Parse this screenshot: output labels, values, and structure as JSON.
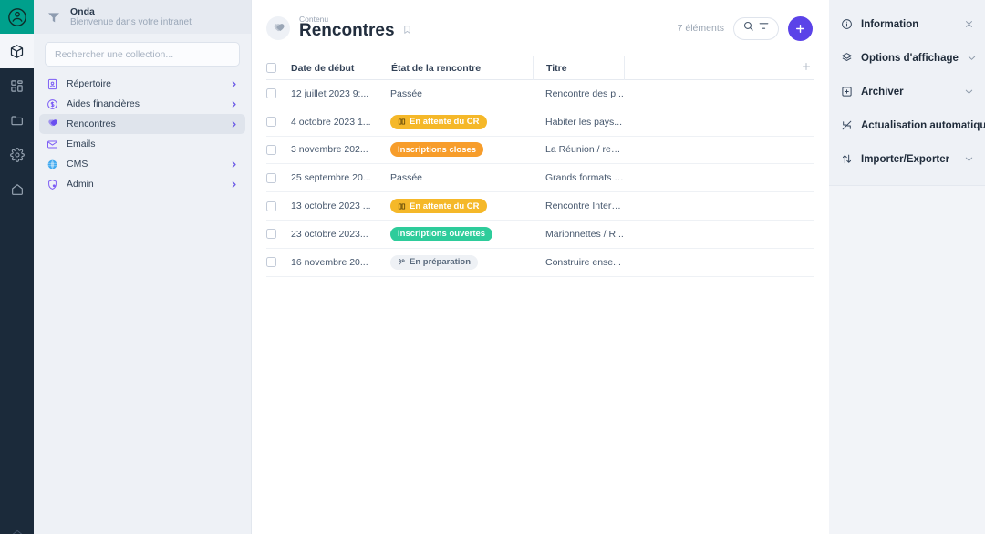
{
  "rail": {
    "logo_name": "app-logo",
    "items": [
      {
        "name": "cube-icon",
        "active": true
      },
      {
        "name": "grid-icon",
        "active": false
      },
      {
        "name": "folder-icon",
        "active": false
      },
      {
        "name": "gear-icon",
        "active": false
      },
      {
        "name": "home-icon",
        "active": false
      }
    ]
  },
  "sidebar": {
    "workspace": {
      "name": "Onda",
      "subtitle": "Bienvenue dans votre intranet",
      "icon": "workspace-logo-icon"
    },
    "search": {
      "placeholder": "Rechercher une collection...",
      "value": ""
    },
    "items": [
      {
        "label": "Répertoire",
        "icon": "contact-card-icon",
        "chevron": true,
        "active": false
      },
      {
        "label": "Aides financières",
        "icon": "dollar-circle-icon",
        "chevron": true,
        "active": false
      },
      {
        "label": "Rencontres",
        "icon": "handshake-icon",
        "chevron": true,
        "active": true
      },
      {
        "label": "Emails",
        "icon": "envelope-icon",
        "chevron": false,
        "active": false
      },
      {
        "label": "CMS",
        "icon": "globe-icon",
        "chevron": true,
        "active": false
      },
      {
        "label": "Admin",
        "icon": "shield-lock-icon",
        "chevron": true,
        "active": false
      }
    ]
  },
  "main": {
    "overline": "Contenu",
    "title": "Rencontres",
    "title_icon": "handshake-icon",
    "bookmark_icon": "bookmark-icon",
    "count": "7 éléments",
    "search_icon": "search-icon",
    "filter_icon": "filter-icon",
    "add_label": "+",
    "add_column_label": "+",
    "columns": [
      {
        "key": "date",
        "label": "Date de début"
      },
      {
        "key": "state",
        "label": "État de la rencontre"
      },
      {
        "key": "title",
        "label": "Titre"
      }
    ],
    "rows": [
      {
        "date": "12 juillet 2023 9:...",
        "state": {
          "text": "Passée",
          "style": "plain",
          "icon": null
        },
        "title": "Rencontre des p..."
      },
      {
        "date": "4 octobre 2023 1...",
        "state": {
          "text": "En attente du CR",
          "style": "amber",
          "icon": "book-icon",
          "color": "#f5b829"
        },
        "title": "Habiter les pays..."
      },
      {
        "date": "3 novembre 202...",
        "state": {
          "text": "Inscriptions closes",
          "style": "orange",
          "icon": null,
          "color": "#f79d2b"
        },
        "title": "La Réunion / ren..."
      },
      {
        "date": "25 septembre 20...",
        "state": {
          "text": "Passée",
          "style": "plain",
          "icon": null
        },
        "title": "Grands formats /..."
      },
      {
        "date": "13 octobre 2023 ...",
        "state": {
          "text": "En attente du CR",
          "style": "amber",
          "icon": "book-icon",
          "color": "#f5b829"
        },
        "title": "Rencontre Intern..."
      },
      {
        "date": "23 octobre 2023...",
        "state": {
          "text": "Inscriptions ouvertes",
          "style": "green",
          "icon": null,
          "color": "#2ecc9b"
        },
        "title": "Marionnettes / R..."
      },
      {
        "date": "16 novembre 20...",
        "state": {
          "text": "En préparation",
          "style": "gray",
          "icon": "tools-icon",
          "color": "#eef1f5"
        },
        "title": "Construire ense..."
      }
    ]
  },
  "right_panel": {
    "items": [
      {
        "label": "Information",
        "icon": "info-icon",
        "action": "close-icon"
      },
      {
        "label": "Options d'affichage",
        "icon": "layers-icon",
        "action": "chevron-down-icon"
      },
      {
        "label": "Archiver",
        "icon": "archive-box-icon",
        "action": "chevron-down-icon"
      },
      {
        "label": "Actualisation automatique",
        "icon": "refresh-off-icon",
        "action": null
      },
      {
        "label": "Importer/Exporter",
        "icon": "import-export-icon",
        "action": "chevron-down-icon"
      }
    ]
  },
  "colors": {
    "accent": "#5b43e8",
    "brand_teal": "#00a08c",
    "rail_dark": "#1b2a3a",
    "panel_bg": "#eef1f6",
    "amber": "#f5b829",
    "orange": "#f79d2b",
    "green": "#2ecc9b"
  }
}
